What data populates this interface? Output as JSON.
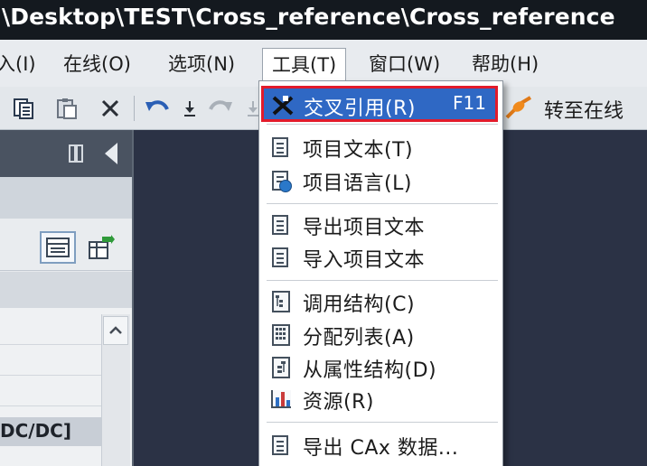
{
  "window": {
    "title": "\\Desktop\\TEST\\Cross_reference\\Cross_reference"
  },
  "menubar": {
    "items": [
      {
        "label": "入(I)"
      },
      {
        "label": "在线(O)"
      },
      {
        "label": "选项(N)"
      },
      {
        "label": "工具(T)"
      },
      {
        "label": "窗口(W)"
      },
      {
        "label": "帮助(H)"
      }
    ],
    "open_menu": "工具(T)"
  },
  "toolbar": {
    "go_online_label": "转至在线",
    "icons": [
      "copy-icon",
      "paste-icon",
      "delete-icon",
      "undo-icon",
      "redo-icon",
      "go-online-icon"
    ]
  },
  "left_panel": {
    "selected_row_text": "DC/DC]"
  },
  "tools_menu": {
    "items": [
      {
        "label": "交叉引用(R)",
        "shortcut": "F11",
        "icon": "cross-reference-icon",
        "highlighted": true
      },
      {
        "label": "项目文本(T)",
        "icon": "document-icon"
      },
      {
        "label": "项目语言(L)",
        "icon": "language-icon"
      },
      {
        "label": "导出项目文本",
        "icon": "document-icon"
      },
      {
        "label": "导入项目文本",
        "icon": "document-icon"
      },
      {
        "label": "调用结构(C)",
        "icon": "call-structure-icon"
      },
      {
        "label": "分配列表(A)",
        "icon": "assignment-list-icon"
      },
      {
        "label": "从属性结构(D)",
        "icon": "dependency-structure-icon"
      },
      {
        "label": "资源(R)",
        "icon": "resources-icon"
      },
      {
        "label": "导出 CAx 数据...",
        "icon": "document-icon"
      }
    ]
  },
  "colors": {
    "highlight": "#2f68c4",
    "annotation_box": "#e21b2b",
    "titlebar": "#14191f",
    "workspace": "#2b3245"
  }
}
